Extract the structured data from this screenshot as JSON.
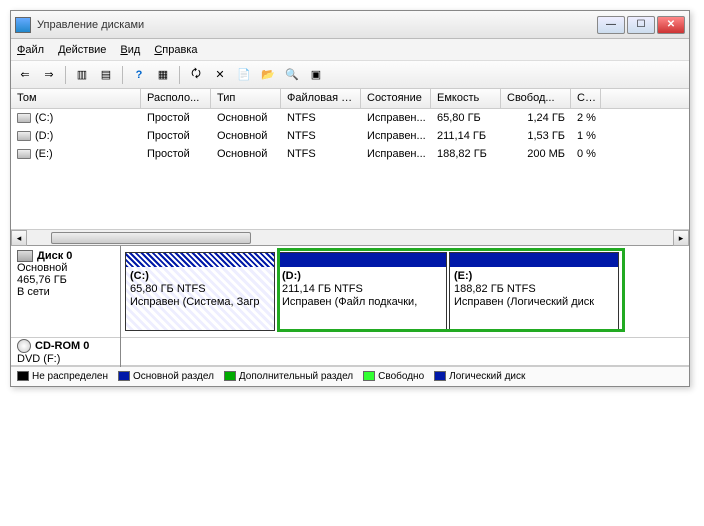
{
  "window": {
    "title": "Управление дисками"
  },
  "menu": {
    "file": "Файл",
    "action": "Действие",
    "view": "Вид",
    "help": "Справка"
  },
  "columns": [
    "Том",
    "Располо...",
    "Тип",
    "Файловая с...",
    "Состояние",
    "Емкость",
    "Свобод...",
    "Св..."
  ],
  "volumes": [
    {
      "name": "(C:)",
      "layout": "Простой",
      "type": "Основной",
      "fs": "NTFS",
      "status": "Исправен...",
      "capacity": "65,80 ГБ",
      "free": "1,24 ГБ",
      "pct": "2 %"
    },
    {
      "name": "(D:)",
      "layout": "Простой",
      "type": "Основной",
      "fs": "NTFS",
      "status": "Исправен...",
      "capacity": "211,14 ГБ",
      "free": "1,53 ГБ",
      "pct": "1 %"
    },
    {
      "name": "(E:)",
      "layout": "Простой",
      "type": "Основной",
      "fs": "NTFS",
      "status": "Исправен...",
      "capacity": "188,82 ГБ",
      "free": "200 МБ",
      "pct": "0 %"
    }
  ],
  "disk0": {
    "title": "Диск 0",
    "type": "Основной",
    "size": "465,76 ГБ",
    "state": "В сети",
    "parts": [
      {
        "name": "(C:)",
        "line2": "65,80 ГБ NTFS",
        "line3": "Исправен (Система, Загр"
      },
      {
        "name": "(D:)",
        "line2": "211,14 ГБ NTFS",
        "line3": "Исправен (Файл подкачки,"
      },
      {
        "name": "(E:)",
        "line2": "188,82 ГБ NTFS",
        "line3": "Исправен (Логический диск"
      }
    ]
  },
  "cdrom": {
    "title": "CD-ROM 0",
    "sub": "DVD (F:)"
  },
  "legend": {
    "l1": "Не распределен",
    "l2": "Основной раздел",
    "l3": "Дополнительный раздел",
    "l4": "Свободно",
    "l5": "Логический диск",
    "c1": "#000",
    "c2": "#0018a8",
    "c3": "#0a0",
    "c4": "#3f3",
    "c5": "#0018a8"
  }
}
